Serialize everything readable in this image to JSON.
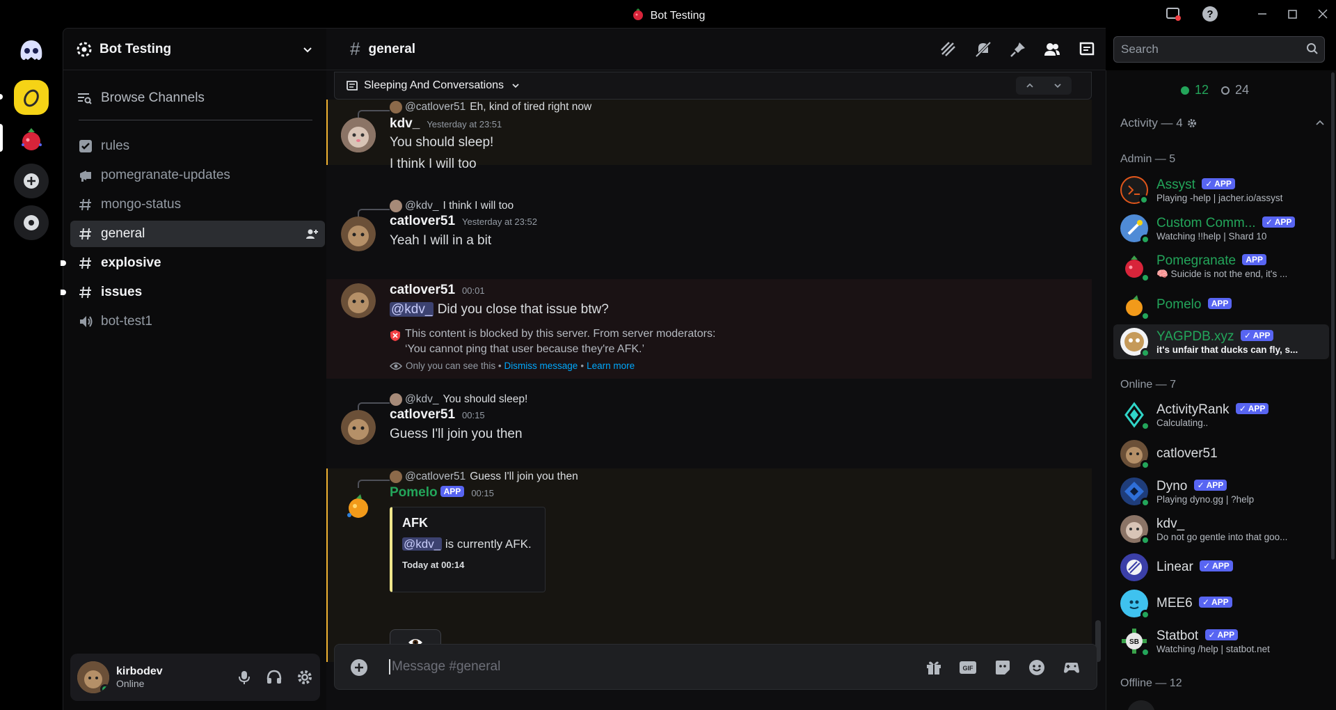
{
  "window": {
    "title": "Bot Testing"
  },
  "guild": {
    "name": "Bot Testing",
    "browse_label": "Browse Channels",
    "channels": [
      {
        "name": "rules",
        "icon": "rules-icon"
      },
      {
        "name": "pomegranate-updates",
        "icon": "announcement-icon"
      },
      {
        "name": "mongo-status",
        "icon": "hash-icon"
      },
      {
        "name": "general",
        "icon": "hash-icon"
      },
      {
        "name": "explosive",
        "icon": "hash-icon"
      },
      {
        "name": "issues",
        "icon": "hash-icon"
      },
      {
        "name": "bot-test1",
        "icon": "voice-icon"
      }
    ]
  },
  "user": {
    "name": "kirbodev",
    "status": "Online"
  },
  "channel": {
    "name": "general",
    "search_placeholder": "Search",
    "thread_title": "Sleeping And Conversations",
    "composer_placeholder": "Message #general"
  },
  "messages": {
    "m1": {
      "reply_author": "@catlover51",
      "reply_text": "Eh, kind of tired right now",
      "author": "kdv_",
      "time": "Yesterday at 23:51",
      "line1": "You should sleep!",
      "line2": "I think I will too"
    },
    "m2": {
      "reply_author": "@kdv_",
      "reply_text": "I think I will too",
      "author": "catlover51",
      "time": "Yesterday at 23:52",
      "line1": "Yeah I will in a bit"
    },
    "m3": {
      "author": "catlover51",
      "time": "00:01",
      "mention": "@kdv_",
      "text": "Did you close that issue btw?",
      "blocked_line1": "This content is blocked by this server. From server moderators:",
      "blocked_line2": "‘You cannot ping that user because they're AFK.’",
      "only_you": "Only you can see this •",
      "dismiss": "Dismiss message",
      "sep": "•",
      "learn_more": "Learn more"
    },
    "m4": {
      "reply_author": "@kdv_",
      "reply_text": "You should sleep!",
      "author": "catlover51",
      "time": "00:15",
      "line1": "Guess I'll join you then"
    },
    "m5": {
      "reply_author": "@catlover51",
      "reply_text": "Guess I'll join you then",
      "author": "Pomelo",
      "badge": "APP",
      "time": "00:15",
      "embed_title": "AFK",
      "embed_mention": "@kdv_",
      "embed_text": "is currently AFK.",
      "embed_footer": "Today at 00:14"
    }
  },
  "members": {
    "online_count": "12",
    "offline_count": "24",
    "activity_label": "Activity — 4",
    "admin_label": "Admin — 5",
    "online_label": "Online — 7",
    "offline_label": "Offline — 12",
    "badge": "✓ APP",
    "admins": [
      {
        "name": "Assyst",
        "sub": "Playing -help | jacher.io/assyst",
        "bot": true
      },
      {
        "name": "Custom Comm...",
        "sub": "Watching !!help | Shard 10",
        "bot": true
      },
      {
        "name": "Pomegranate",
        "sub": "🧠 Suicide is not the end, it's ...",
        "bot": true
      },
      {
        "name": "Pomelo",
        "sub": "",
        "bot": true
      },
      {
        "name": "YAGPDB.xyz",
        "sub": "it's unfair that ducks can fly, s...",
        "bot": true
      }
    ],
    "online": [
      {
        "name": "ActivityRank",
        "sub": "Calculating..",
        "bot": true
      },
      {
        "name": "catlover51",
        "sub": "",
        "bot": false
      },
      {
        "name": "Dyno",
        "sub": "Playing dyno.gg | ?help",
        "bot": true
      },
      {
        "name": "kdv_",
        "sub": "Do not go gentle into that goo...",
        "bot": false
      },
      {
        "name": "Linear",
        "sub": "",
        "bot": true
      },
      {
        "name": "MEE6",
        "sub": "",
        "bot": true
      },
      {
        "name": "Statbot",
        "sub": "Watching /help | statbot.net",
        "bot": true
      }
    ]
  },
  "colors": {
    "accent": "#5865f2",
    "online": "#23a55a",
    "mention_bar": "#f0b232"
  }
}
